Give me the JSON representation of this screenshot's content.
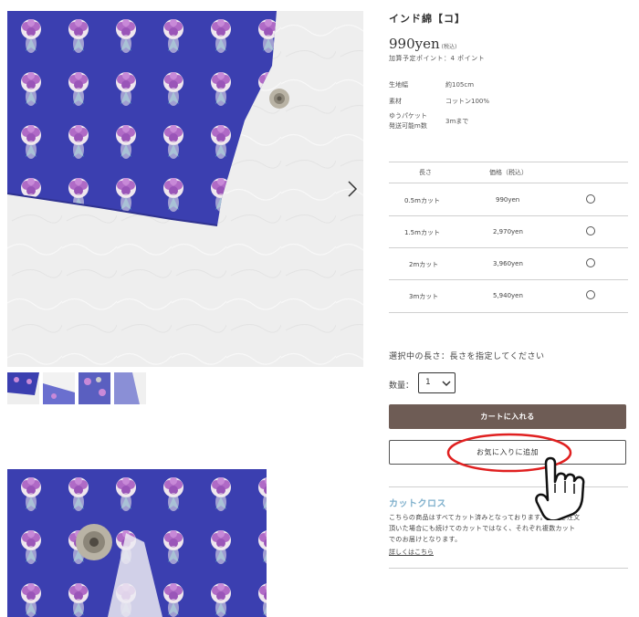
{
  "product": {
    "title": "インド綿【コ】",
    "price": "990yen",
    "tax_note": "(税込)",
    "points": "加算予定ポイント：4 ポイント"
  },
  "specs": [
    {
      "label": "生地幅",
      "value": "約105cm"
    },
    {
      "label": "素材",
      "value": "コットン100%"
    },
    {
      "label": "ゆうパケット\n発送可能m数",
      "value": "3mまで"
    }
  ],
  "length_table": {
    "headers": [
      "長さ",
      "価格（税込）"
    ],
    "rows": [
      {
        "length": "0.5mカット",
        "price": "990yen"
      },
      {
        "length": "1.5mカット",
        "price": "2,970yen"
      },
      {
        "length": "2mカット",
        "price": "3,960yen"
      },
      {
        "length": "3mカット",
        "price": "5,940yen"
      }
    ]
  },
  "selection": {
    "selected_length_text": "選択中の長さ：長さを指定してください",
    "quantity_label": "数量：",
    "quantity_value": "1"
  },
  "buttons": {
    "add_to_cart": "カートに入れる",
    "add_to_favorites": "お気に入りに追加"
  },
  "cut_cloth": {
    "title": "カットクロス",
    "description": "こちらの商品はすべてカット済みとなっております。複数ご注文頂いた場合にも続けてのカットではなく、それぞれ複数カットでのお届けとなります。",
    "link": "詳しくはこちら"
  },
  "icons": {
    "next": "chevron-right-icon",
    "dropdown": "chevron-down-icon",
    "annotation": "pointing-hand-icon"
  },
  "colors": {
    "cart_button": "#6e5c55",
    "fabric_blue": "#3b3fb0",
    "cut_title": "#7fb0cc",
    "annotation_red": "#e02020"
  }
}
